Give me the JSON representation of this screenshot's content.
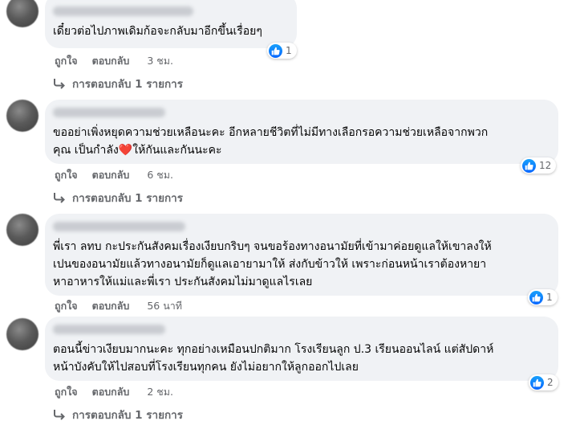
{
  "comments": [
    {
      "text": "เดี๋ยวต่อไปภาพเดิมก้อจะกลับมาอีกขึ้นเรื่อยๆ",
      "reactions": "1",
      "like_label": "ถูกใจ",
      "reply_label": "ตอบกลับ",
      "time": "3 ชม.",
      "replies_label": "การตอบกลับ 1 รายการ"
    },
    {
      "text_line1": "ขออย่าเพิ่งหยุดความช่วยเหลือนะคะ อีกหลายชีวิตที่ไม่มีทางเลือกรอความช่วยเหลือจากพวก",
      "text_line2_a": "คุณ เป็นกำลัง",
      "heart": "❤️",
      "text_line2_b": "ให้กันและกันนะคะ",
      "reactions": "12",
      "like_label": "ถูกใจ",
      "reply_label": "ตอบกลับ",
      "time": "6 ชม.",
      "replies_label": "การตอบกลับ 1 รายการ"
    },
    {
      "text_line1": "พี่เรา ลทบ กะประกันสังคมเรื่องเงียบกริบๆ จนขอร้องทางอนามัยที่เข้ามาค่อยดูแลให้เขาลงให้",
      "text_line2": "เปนของอนามัยแล้วทางอนามัยก็ดูแลเอายามาให้ ส่งกับข้าวให้ เพราะก่อนหน้าเราต้องหายา",
      "text_line3": "หาอาหารให้แม่และพี่เรา ประกันสังคมไม่มาดูแลไรเลย",
      "reactions": "1",
      "like_label": "ถูกใจ",
      "reply_label": "ตอบกลับ",
      "time": "56 นาที"
    },
    {
      "text_line1": "ตอนนี้ข่าวเงียบมากนะคะ ทุกอย่างเหมือนปกติมาก โรงเรียนลูก ป.3 เรียนออนไลน์ แต่สัปดาห์",
      "text_line2": "หน้าบังคับให้ไปสอบที่โรงเรียนทุกคน ยังไม่อยากให้ลูกออกไปเลย",
      "reactions": "2",
      "like_label": "ถูกใจ",
      "reply_label": "ตอบกลับ",
      "time": "2 ชม.",
      "replies_label": "การตอบกลับ 1 รายการ"
    }
  ]
}
